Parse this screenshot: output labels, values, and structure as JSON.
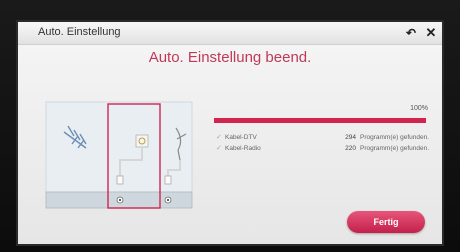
{
  "window": {
    "title": "Auto. Einstellung",
    "back_icon": "back-arrow-icon",
    "close_icon": "close-icon",
    "back_glyph": "↶",
    "close_glyph": "✕"
  },
  "main": {
    "heading": "Auto. Einstellung beend.",
    "progress": {
      "label": "100%",
      "value": 1.0,
      "color": "#d0244f"
    },
    "results": [
      {
        "name": "Kabel-DTV",
        "count": "294",
        "unit": "Programm(e) gefunden."
      },
      {
        "name": "Kabel-Radio",
        "count": "220",
        "unit": "Programm(e) gefunden."
      }
    ],
    "check_glyph": "✓",
    "done_button": "Fertig"
  },
  "colors": {
    "accent": "#d0244f",
    "heading": "#c0395a"
  }
}
